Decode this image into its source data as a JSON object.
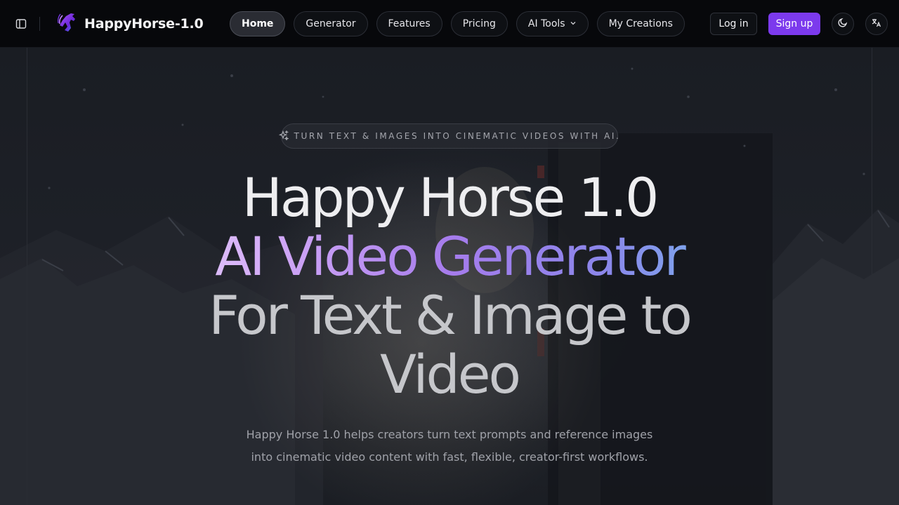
{
  "header": {
    "brand_name": "HappyHorse-1.0",
    "nav": [
      {
        "label": "Home",
        "active": true
      },
      {
        "label": "Generator",
        "active": false
      },
      {
        "label": "Features",
        "active": false
      },
      {
        "label": "Pricing",
        "active": false
      },
      {
        "label": "AI Tools",
        "active": false,
        "has_dropdown": true
      },
      {
        "label": "My Creations",
        "active": false
      }
    ],
    "login_label": "Log in",
    "signup_label": "Sign up",
    "icons": {
      "sidebar_toggle": "sidebar-toggle-icon",
      "logo": "horse-logo-icon",
      "theme": "moon-icon",
      "language": "translate-icon",
      "dropdown": "chevron-down-icon"
    }
  },
  "hero": {
    "tagline": "Turn text & images into cinematic videos with AI.",
    "tagline_icon": "sparkles-icon",
    "headline": {
      "line1": "Happy Horse 1.0",
      "line2": "AI Video Generator",
      "line3": "For Text & Image to",
      "line4": "Video"
    },
    "subtitle": "Happy Horse 1.0 helps creators turn text prompts and reference images into cinematic video content with fast, flexible, creator-first workflows."
  },
  "colors": {
    "accent": "#7c3aed",
    "header_bg": "#07080b",
    "hero_gradient": [
      "#f1e3ff",
      "#a67cec",
      "#6ec8f0"
    ]
  }
}
